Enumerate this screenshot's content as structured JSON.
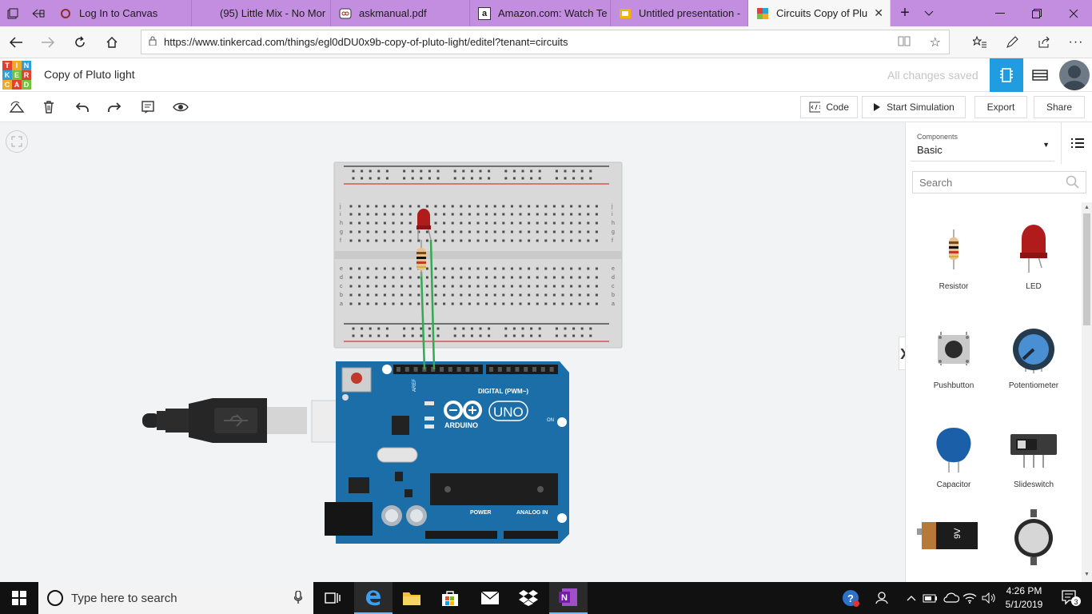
{
  "browser": {
    "tabs": [
      {
        "label": "Log In to Canvas",
        "active": false
      },
      {
        "label": "(95) Little Mix - No Mor",
        "active": false
      },
      {
        "label": "askmanual.pdf",
        "active": false
      },
      {
        "label": "Amazon.com: Watch Te",
        "active": false
      },
      {
        "label": "Untitled presentation -",
        "active": false
      },
      {
        "label": "Circuits Copy of Plu",
        "active": true
      }
    ],
    "url": "https://www.tinkercad.com/things/egl0dDU0x9b-copy-of-pluto-light/editel?tenant=circuits"
  },
  "app": {
    "logo_letters": [
      "T",
      "I",
      "N",
      "K",
      "E",
      "R",
      "C",
      "A",
      "D"
    ],
    "logo_colors": [
      "#e2422d",
      "#f0a92d",
      "#2f9fd8",
      "#2f9fd8",
      "#74c13a",
      "#e2422d",
      "#f0a92d",
      "#e2422d",
      "#74c13a"
    ],
    "design_title": "Copy of Pluto light",
    "save_status": "All changes saved",
    "accent_color": "#1f9de0"
  },
  "toolbar": {
    "code_label": "Code",
    "simulate_label": "Start Simulation",
    "export_label": "Export",
    "share_label": "Share"
  },
  "panel": {
    "dropdown_caption": "Components",
    "dropdown_value": "Basic",
    "search_placeholder": "Search",
    "components": [
      {
        "label": "Resistor"
      },
      {
        "label": "LED"
      },
      {
        "label": "Pushbutton"
      },
      {
        "label": "Potentiometer"
      },
      {
        "label": "Capacitor"
      },
      {
        "label": "Slideswitch"
      },
      {
        "label": "9V",
        "visible_label": false
      },
      {
        "label": "CR2032",
        "visible_label": false
      }
    ]
  },
  "circuit": {
    "breadboard_rows_top": [
      "j",
      "i",
      "h",
      "g",
      "f"
    ],
    "breadboard_rows_bottom": [
      "e",
      "d",
      "c",
      "b",
      "a"
    ],
    "arduino_logo_text": "ARDUINO",
    "arduino_model": "UNO",
    "digital_label": "DIGITAL (PWM~)",
    "power_label": "POWER",
    "analog_label": "ANALOG IN",
    "on_label": "ON",
    "battery_label": "9V"
  },
  "taskbar": {
    "search_placeholder": "Type here to search",
    "time": "4:26 PM",
    "date": "5/1/2019",
    "notification_count": "3"
  }
}
